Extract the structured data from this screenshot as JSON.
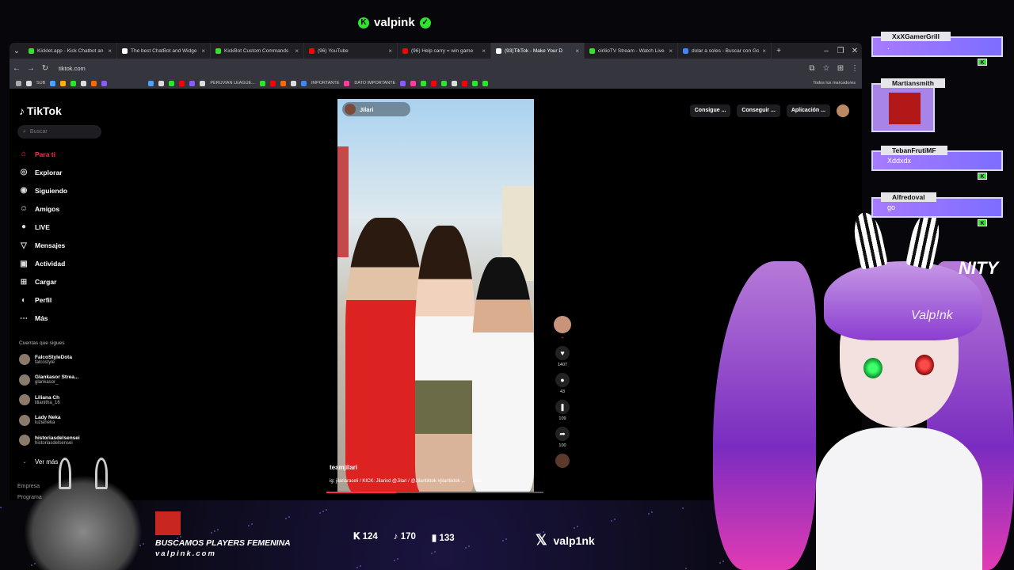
{
  "stream": {
    "top_handle": "valpink",
    "recruit_text": "BUSCAMOS PLAYERS FEMENINA",
    "site": "valpink.com",
    "stats": [
      "124",
      "170",
      "133"
    ],
    "x_handle": "valp1nk",
    "avatar_signature": "Valp!nk",
    "unity_text": "NITY",
    "corner_lines": [
      "Empresa",
      "Programa"
    ]
  },
  "browser": {
    "tabs": [
      {
        "label": "Kicklet.app - Kick Chatbot an",
        "color": "#2ee52e"
      },
      {
        "label": "The best ChatBot and Widge",
        "color": "#ffffff"
      },
      {
        "label": "KickBot Custom Commands",
        "color": "#2ee52e"
      },
      {
        "label": "(96) YouTube",
        "color": "#ff0000"
      },
      {
        "label": "(96) Help carry = win game",
        "color": "#ff0000"
      },
      {
        "label": "(93)TikTok - Make Your D",
        "color": "#ffffff",
        "active": true
      },
      {
        "label": "cirilioTV Stream - Watch Live",
        "color": "#2ee52e"
      },
      {
        "label": "dolar a soles - Buscar con Go",
        "color": "#4285f4"
      }
    ],
    "url": "tiktok.com",
    "bookmarks": [
      "SUB",
      "PERUVIAN LEAGUE...",
      "IMPORTANTE",
      "DATO IMPORTANTE",
      "Todos los marcadores"
    ]
  },
  "tiktok": {
    "logo": "TikTok",
    "search_placeholder": "Buscar",
    "nav": [
      "Para ti",
      "Explorar",
      "Siguiendo",
      "Amigos",
      "LIVE",
      "Mensajes",
      "Actividad",
      "Cargar",
      "Perfil",
      "Más"
    ],
    "follows_heading": "Cuentas que sigues",
    "follows": [
      {
        "name": "FalcoStyleDota",
        "handle": "falcostyle"
      },
      {
        "name": "Glankasor Strea...",
        "handle": "glankasor_"
      },
      {
        "name": "Liliana Ch",
        "handle": "lilianitha_16"
      },
      {
        "name": "Lady Neka",
        "handle": "luzianeka"
      },
      {
        "name": "historiasdelsensei",
        "handle": "historiasdelsensei"
      }
    ],
    "see_more": "Ver más",
    "top_buttons": [
      "Consigue ...",
      "Conseguir ...",
      "Aplicación ..."
    ],
    "video": {
      "creator_tag": "Jilari",
      "username": "teamjilari",
      "description": "ig: jilariaraceli / KICK: Jilarixd @Jilari / @Jilaritiktok #jilaritiktok ...",
      "more": "más",
      "progress": 0.32
    },
    "actions": {
      "likes": "1407",
      "comments": "43",
      "saves": "109",
      "shares": "100"
    }
  },
  "chat": [
    {
      "user": "XxXGamerGrill",
      "message": "."
    },
    {
      "user": "Martiansmith",
      "message": ""
    },
    {
      "user": "TebanFrutiMF",
      "message": "Xddxdx"
    },
    {
      "user": "Alfredoval",
      "message": "go"
    }
  ]
}
